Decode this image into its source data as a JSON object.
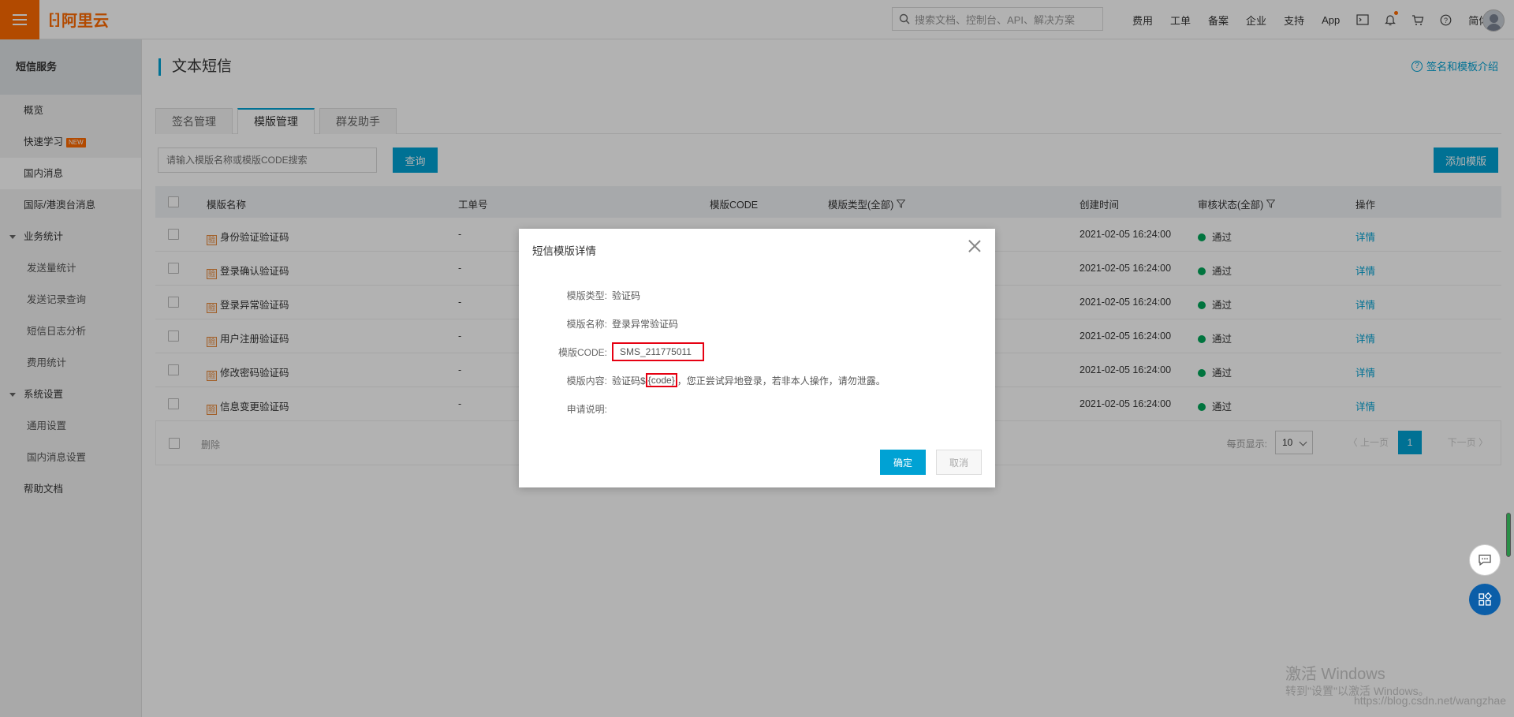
{
  "topbar": {
    "logo_text": "阿里云",
    "logo_mark": "[-]",
    "search_placeholder": "搜索文档、控制台、API、解决方案",
    "nav": [
      "费用",
      "工单",
      "备案",
      "企业",
      "支持",
      "App"
    ],
    "lang": "简体"
  },
  "sidebar": {
    "title": "短信服务",
    "items": [
      {
        "label": "概览",
        "type": "item"
      },
      {
        "label": "快速学习",
        "type": "item",
        "badge": "NEW"
      },
      {
        "label": "国内消息",
        "type": "item",
        "active": true
      },
      {
        "label": "国际/港澳台消息",
        "type": "item"
      },
      {
        "label": "业务统计",
        "type": "group"
      },
      {
        "label": "发送量统计",
        "type": "sub"
      },
      {
        "label": "发送记录查询",
        "type": "sub"
      },
      {
        "label": "短信日志分析",
        "type": "sub"
      },
      {
        "label": "费用统计",
        "type": "sub"
      },
      {
        "label": "系统设置",
        "type": "group"
      },
      {
        "label": "通用设置",
        "type": "sub"
      },
      {
        "label": "国内消息设置",
        "type": "sub"
      },
      {
        "label": "帮助文档",
        "type": "item"
      }
    ]
  },
  "main": {
    "title": "文本短信",
    "help_link": "签名和模板介绍",
    "tabs": [
      "签名管理",
      "模版管理",
      "群发助手"
    ],
    "active_tab": 1,
    "search_placeholder": "请输入模版名称或模版CODE搜索",
    "query_label": "查询",
    "add_label": "添加模版"
  },
  "table": {
    "headers": {
      "name": "模版名称",
      "ticket": "工单号",
      "code": "模版CODE",
      "type": "模版类型(全部)",
      "created": "创建时间",
      "status": "审核状态(全部)",
      "action": "操作"
    },
    "tag": "验",
    "rows": [
      {
        "name": "身份验证验证码",
        "ticket": "-",
        "created": "2021-02-05 16:24:00",
        "status": "通过",
        "action": "详情"
      },
      {
        "name": "登录确认验证码",
        "ticket": "-",
        "created": "2021-02-05 16:24:00",
        "status": "通过",
        "action": "详情"
      },
      {
        "name": "登录异常验证码",
        "ticket": "-",
        "created": "2021-02-05 16:24:00",
        "status": "通过",
        "action": "详情"
      },
      {
        "name": "用户注册验证码",
        "ticket": "-",
        "created": "2021-02-05 16:24:00",
        "status": "通过",
        "action": "详情"
      },
      {
        "name": "修改密码验证码",
        "ticket": "-",
        "created": "2021-02-05 16:24:00",
        "status": "通过",
        "action": "详情"
      },
      {
        "name": "信息变更验证码",
        "ticket": "-",
        "created": "2021-02-05 16:24:00",
        "status": "通过",
        "action": "详情"
      }
    ],
    "footer": {
      "delete_label": "删除",
      "page_size_label": "每页显示:",
      "page_size": "10",
      "prev": "上一页",
      "current_page": "1",
      "next": "下一页"
    }
  },
  "modal": {
    "title": "短信模版详情",
    "fields": {
      "type_label": "模版类型:",
      "type_value": "验证码",
      "name_label": "模版名称:",
      "name_value": "登录异常验证码",
      "code_label": "模版CODE:",
      "code_value": "SMS_211775011",
      "content_label": "模版内容:",
      "content_prefix": "验证码$",
      "content_var": "{code}",
      "content_suffix": "，您正尝试异地登录，若非本人操作，请勿泄露。",
      "desc_label": "申请说明:"
    },
    "ok_label": "确定",
    "cancel_label": "取消"
  },
  "watermark": {
    "line1": "激活 Windows",
    "line2": "转到\"设置\"以激活 Windows。",
    "url": "https://blog.csdn.net/wangzhae"
  },
  "colors": {
    "brand": "#ff6a00",
    "accent": "#00a2d4",
    "highlight": "#e60012",
    "success": "#00a65a"
  }
}
